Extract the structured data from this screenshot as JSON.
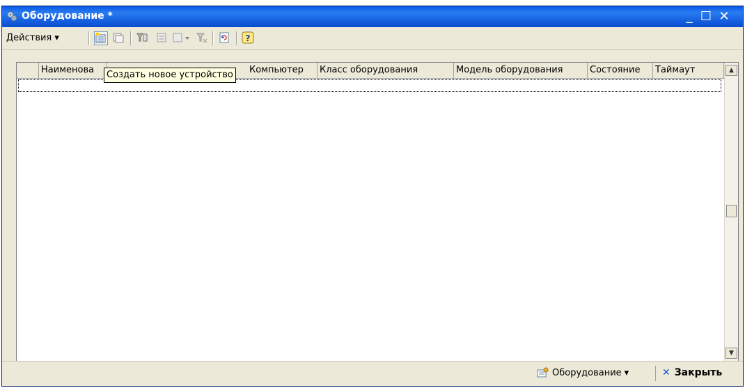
{
  "window": {
    "title": "Оборудование *",
    "minimize": "_",
    "maximize": "☐",
    "close": "✕"
  },
  "toolbar": {
    "actions_label": "Действия",
    "actions_arrow": "▾",
    "icons": [
      "add-device-icon",
      "copy-device-icon",
      "filter-icon",
      "filter-list-icon",
      "filter-dropdown-icon",
      "clear-filter-icon",
      "refresh-icon",
      "help-icon"
    ]
  },
  "tooltip": {
    "text": "Создать новое устройство"
  },
  "table": {
    "columns": [
      "",
      "Наименова",
      "Компьютер",
      "Класс оборудования",
      "Модель оборудования",
      "Состояние",
      "Таймаут"
    ],
    "rows": []
  },
  "bottom": {
    "equipment_label": "Оборудование",
    "equipment_arrow": "▾",
    "close_label": "Закрыть",
    "close_icon": "✕"
  },
  "colors": {
    "titlebar": "#0a58e6",
    "panel": "#ece9d8",
    "tooltip_bg": "#ffffe1"
  }
}
